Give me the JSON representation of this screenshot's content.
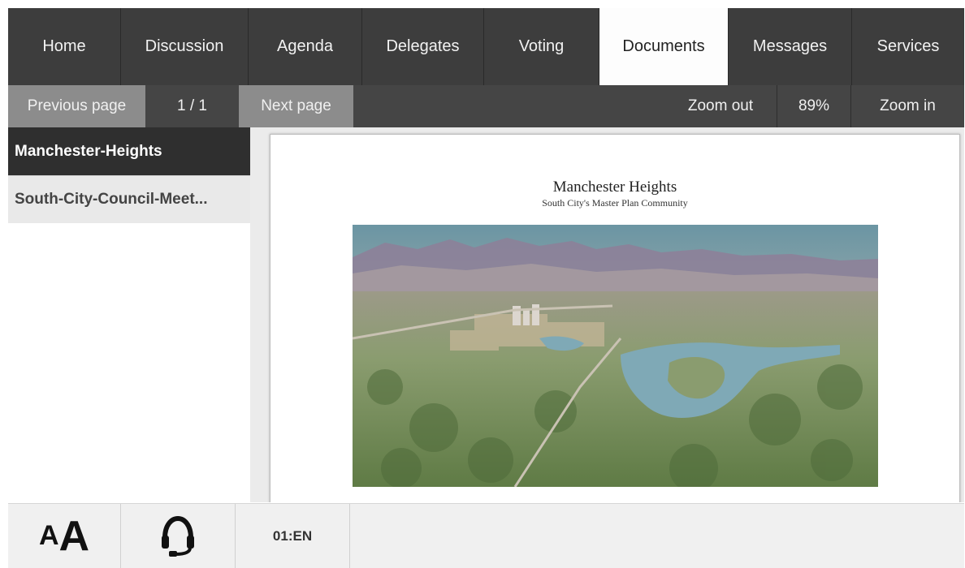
{
  "tabs": [
    {
      "label": "Home",
      "active": false
    },
    {
      "label": "Discussion",
      "active": false
    },
    {
      "label": "Agenda",
      "active": false
    },
    {
      "label": "Delegates",
      "active": false
    },
    {
      "label": "Voting",
      "active": false
    },
    {
      "label": "Documents",
      "active": true
    },
    {
      "label": "Messages",
      "active": false
    },
    {
      "label": "Services",
      "active": false
    }
  ],
  "toolbar": {
    "previous_label": "Previous page",
    "page_indicator": "1 / 1",
    "next_label": "Next page",
    "zoom_out_label": "Zoom out",
    "zoom_level": "89%",
    "zoom_in_label": "Zoom in"
  },
  "documents": [
    {
      "label": "Manchester-Heights",
      "active": true
    },
    {
      "label": "South-City-Council-Meet...",
      "active": false
    }
  ],
  "document_page": {
    "title": "Manchester Heights",
    "subtitle": "South City's Master Plan Community"
  },
  "bottom": {
    "font_size_small": "A",
    "font_size_big": "A",
    "headset_icon": "headset-icon",
    "channel": "01:EN"
  },
  "colors": {
    "tab_bar": "#3d3d3d",
    "active_tab": "#fdfdfd",
    "toolbar": "#454545",
    "toolbar_button_light": "#8c8c8c",
    "active_document": "#2f2f2f"
  }
}
